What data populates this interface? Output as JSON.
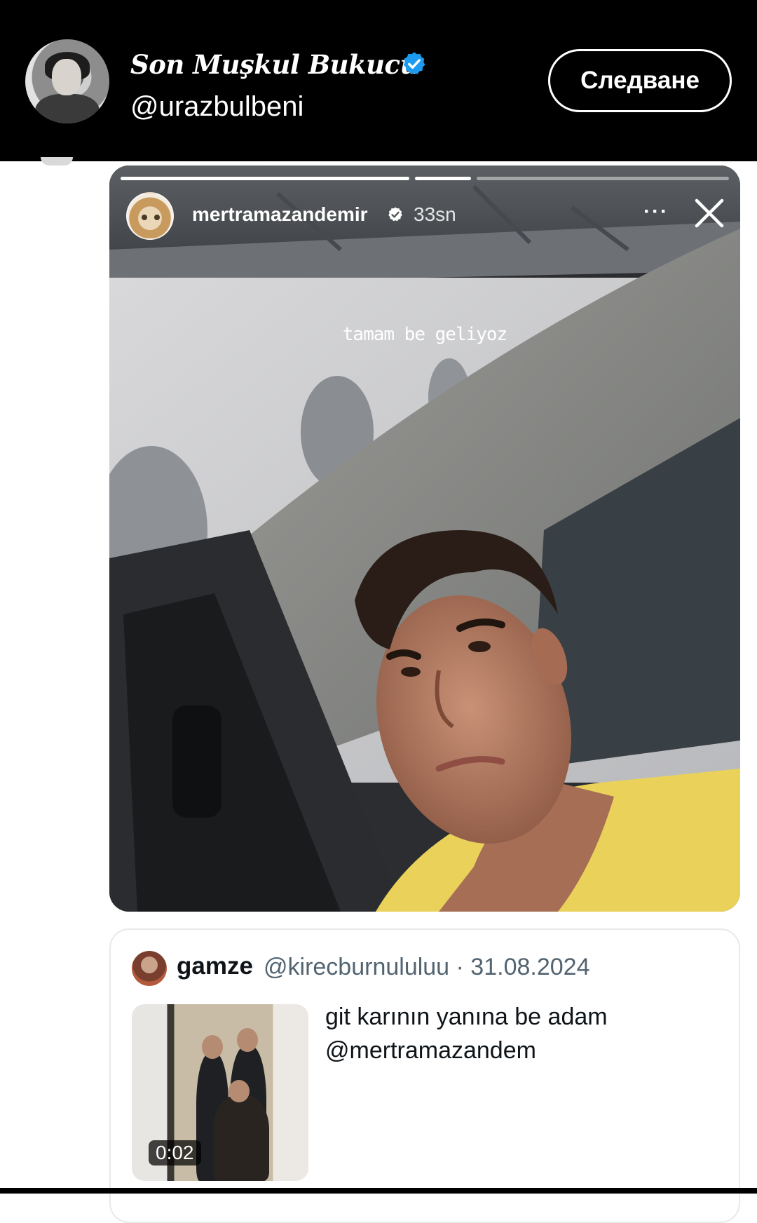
{
  "header": {
    "display_name": "Son Muşkul Bukucu",
    "handle": "@urazbulbeni",
    "follow_label": "Следване",
    "accent_color": "#1d9bf0"
  },
  "story": {
    "username": "mertramazandemir",
    "time": "33sn",
    "more_label": "···",
    "caption": "tamam be geliyoz",
    "progress_segments": [
      {
        "fill": 1.0
      },
      {
        "fill": 1.0
      },
      {
        "fill": 0.0
      }
    ]
  },
  "quote": {
    "name": "gamze",
    "meta": "@kirecburnululuu · 31.08.2024",
    "text_line1": "git karının yanına be adam",
    "text_line2": "@mertramazandem",
    "video_duration": "0:02"
  }
}
